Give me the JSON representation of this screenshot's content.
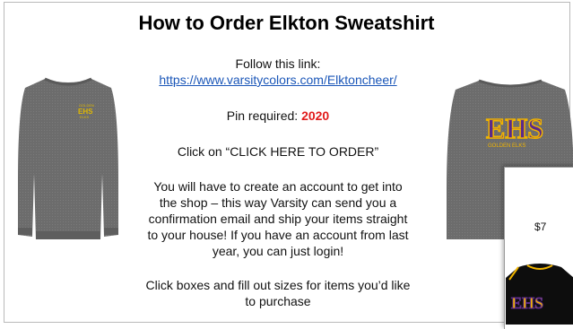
{
  "title": "How to Order Elkton Sweatshirt",
  "follow_label": "Follow this link:",
  "link_url": "https://www.varsitycolors.com/Elktoncheer/",
  "pin_label": "Pin required: ",
  "pin_code": "2020",
  "click_instruction": "Click on “CLICK HERE TO ORDER”",
  "account_lines": [
    "You will have to create an account to get into",
    "the shop – this way Varsity can send you a",
    "confirmation email and ship your items straight",
    "to your house! If you have an account from last",
    "year, you can just login!"
  ],
  "boxes_lines": [
    "Click boxes and fill out sizes for items you’d like",
    "to purchase"
  ],
  "left_shirt": {
    "logo_top": "GOLDEN",
    "logo_mid": "EHS",
    "logo_bottom": "ELKS"
  },
  "right_shirt": {
    "logo": "EHS",
    "logo_sub": "GOLDEN ELKS"
  },
  "inset": {
    "price": "$7",
    "jersey_logo": "EHS"
  },
  "colors": {
    "link": "#1a56b8",
    "pin": "#e11b1b",
    "shirt_gray": "#6f6f6f",
    "purple": "#5a2a8a",
    "gold": "#f0b400"
  }
}
